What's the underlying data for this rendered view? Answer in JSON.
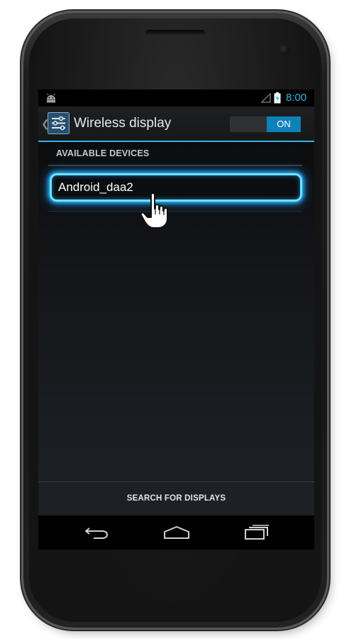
{
  "status_bar": {
    "time": "8:00"
  },
  "action_bar": {
    "title": "Wireless display",
    "toggle_label": "ON"
  },
  "devices_section": {
    "header": "AVAILABLE DEVICES",
    "items": [
      {
        "name": "Android_daa2"
      }
    ]
  },
  "bottom_action": {
    "label": "SEARCH FOR DISPLAYS"
  },
  "colors": {
    "accent": "#33b5e5",
    "toggle_on": "#0e81b8",
    "highlight_glow": "#2bb8ff"
  },
  "icons": [
    "android-icon",
    "signal-icon",
    "battery-charging-icon",
    "settings-icon",
    "pointing-hand-icon",
    "back-nav-icon",
    "home-nav-icon",
    "recents-nav-icon"
  ]
}
